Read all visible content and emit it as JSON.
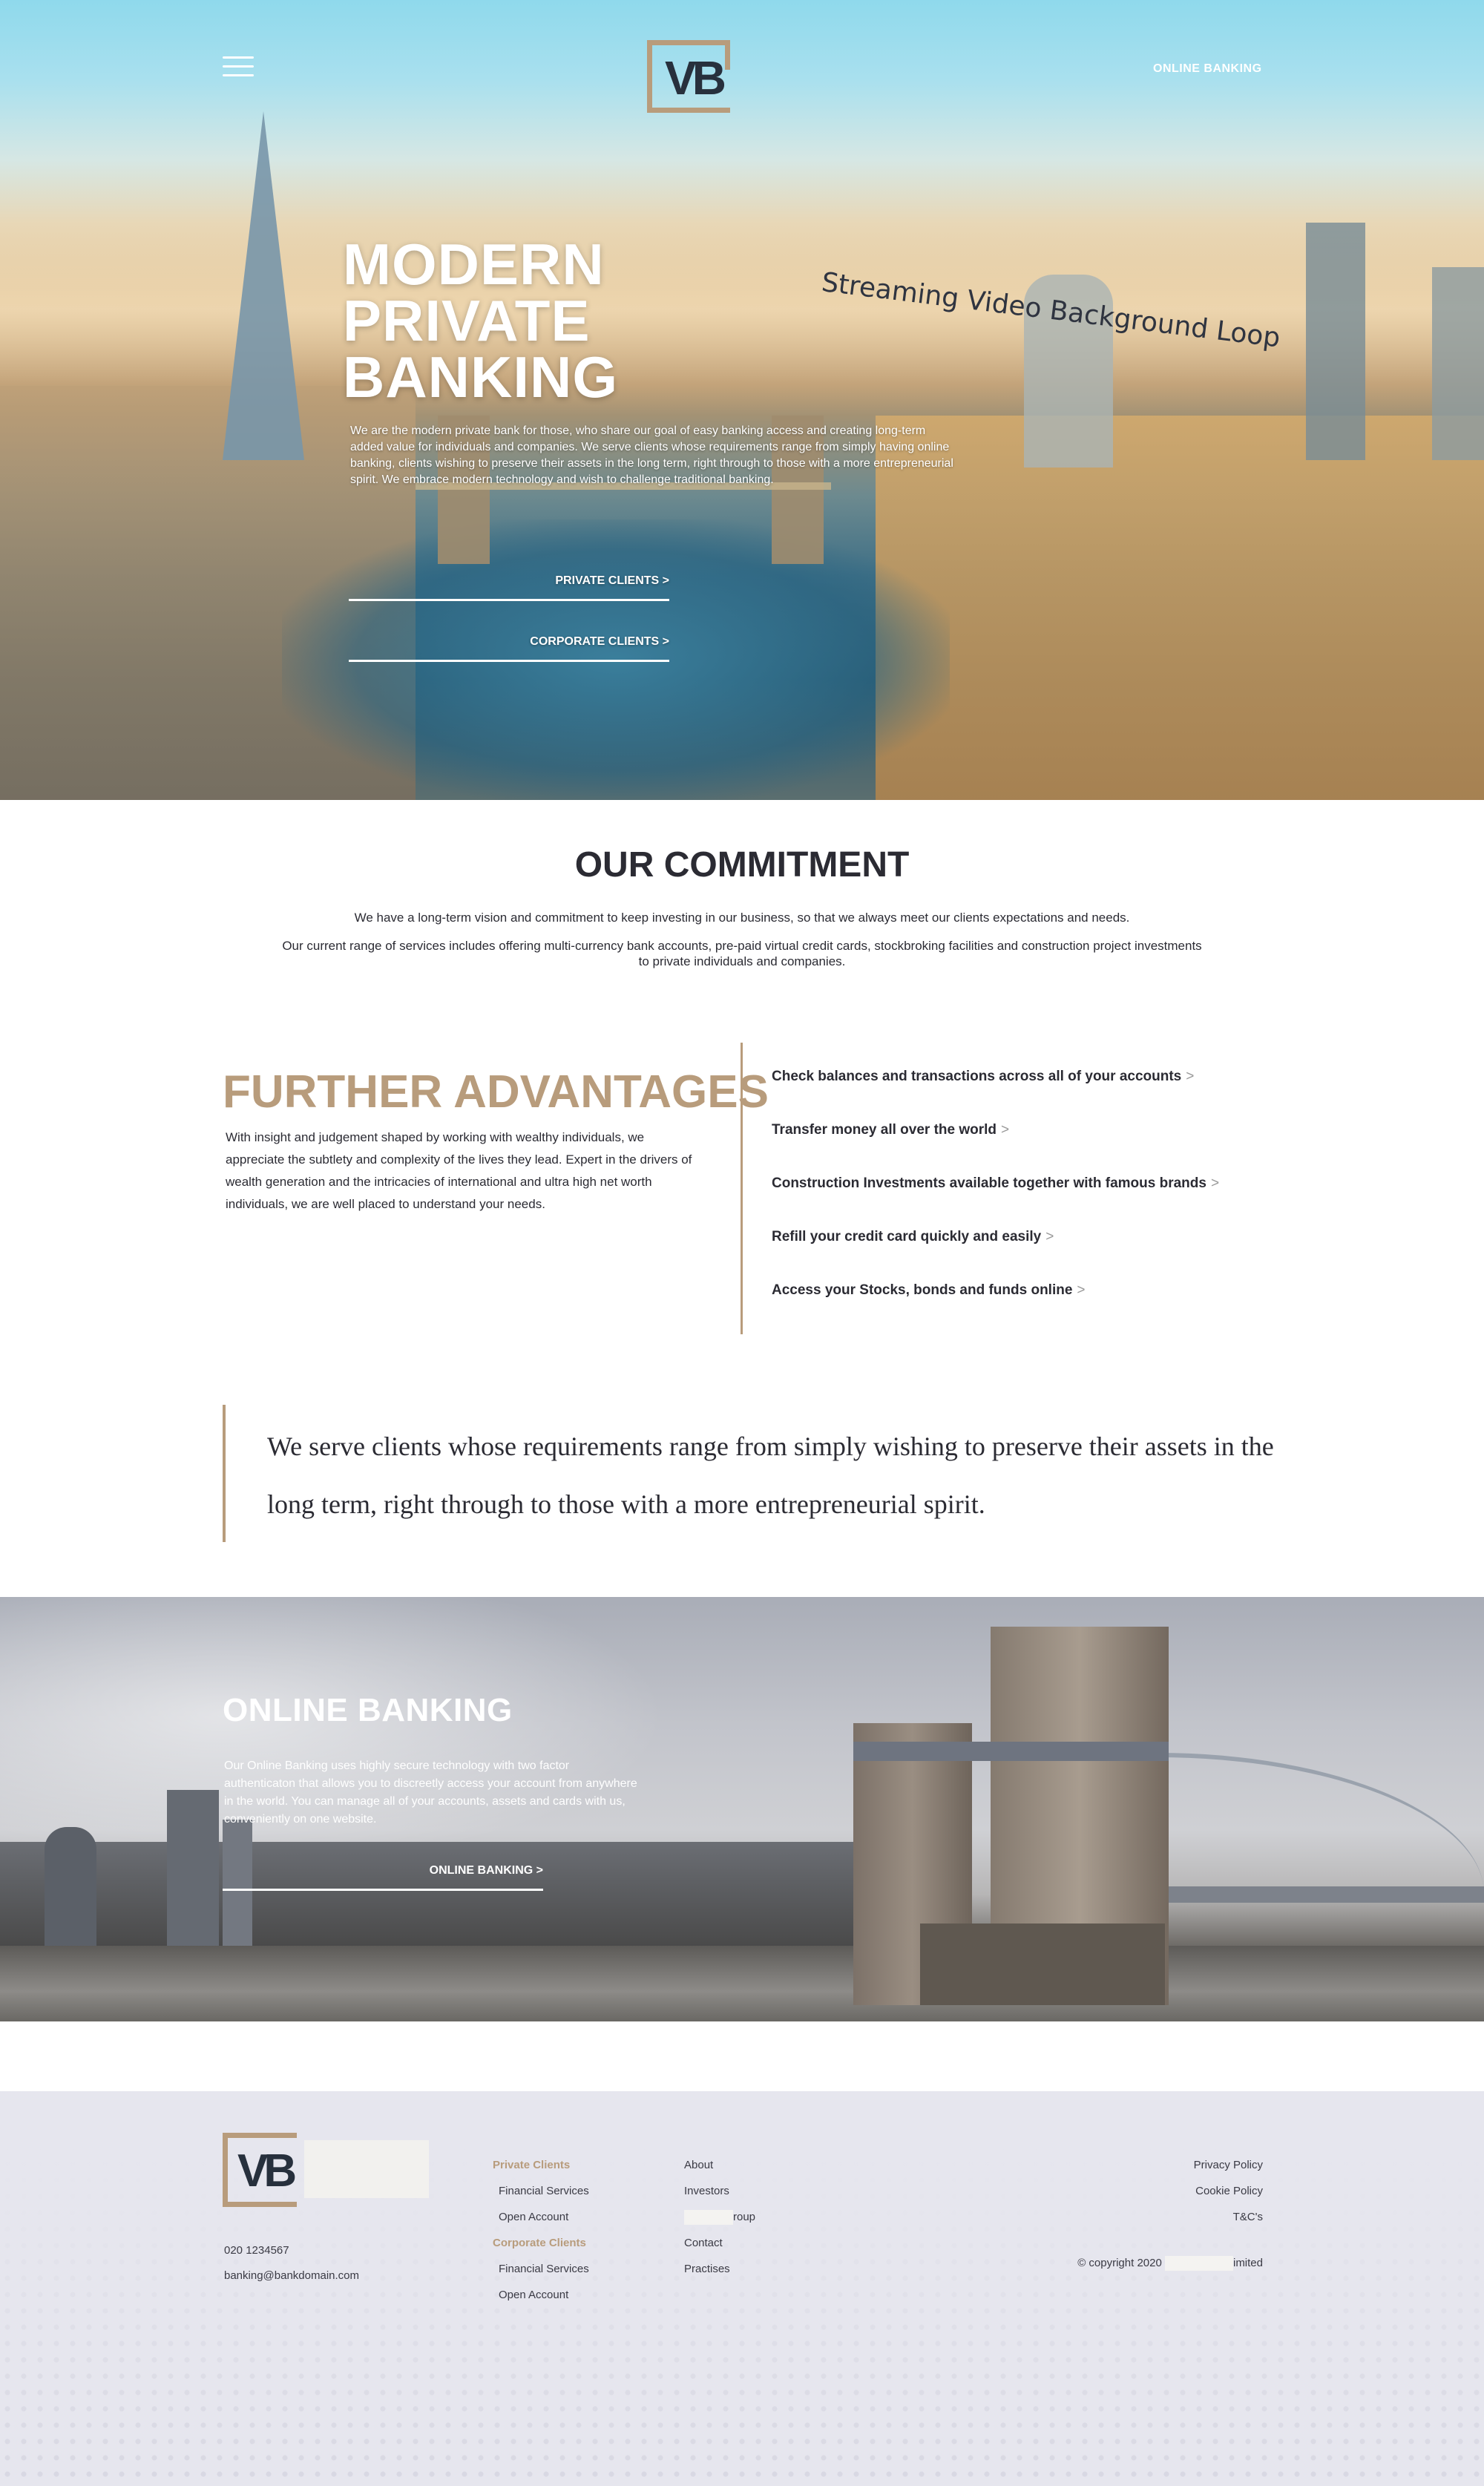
{
  "header": {
    "logo_text": "VB",
    "online_banking_label": "ONLINE BANKING"
  },
  "hero": {
    "title_line1": "MODERN",
    "title_line2": "PRIVATE",
    "title_line3": "BANKING",
    "text": "We are the modern private bank for those, who share our goal of easy banking access and creating long-term added value for individuals and companies. We serve clients whose requirements range from simply having online banking, clients wishing to preserve their assets in the long term, right through to those with a more entrepreneurial spirit. We embrace modern technology and wish to challenge traditional banking.",
    "video_note": "Streaming Video Background Loop",
    "private_clients_label": "PRIVATE CLIENTS >",
    "corporate_clients_label": "CORPORATE CLIENTS >"
  },
  "commitment": {
    "title": "OUR COMMITMENT",
    "p1": "We have a long-term vision and commitment to keep investing in our business, so that we always meet our clients expectations and needs.",
    "p2": "Our current range of services includes offering multi-currency bank accounts, pre-paid virtual credit cards, stockbroking facilities and construction project investments to private individuals and companies."
  },
  "advantages": {
    "title": "FURTHER ADVANTAGES",
    "text": "With insight and judgement shaped by working with wealthy individuals, we appreciate the subtlety and complexity of the lives they lead. Expert in the drivers of wealth generation and the intricacies of international and ultra high net worth individuals, we are well placed to understand your needs.",
    "items": [
      {
        "label": "Check balances and transactions across all of your accounts",
        "arrow": ">"
      },
      {
        "label": "Transfer money all over the world",
        "arrow": ">"
      },
      {
        "label": "Construction Investments available together with famous brands",
        "arrow": ">"
      },
      {
        "label": "Refill your credit card quickly and easily",
        "arrow": ">"
      },
      {
        "label": "Access your Stocks, bonds and funds online",
        "arrow": ">"
      }
    ]
  },
  "quote": {
    "text": "We serve clients whose requirements range from simply wishing to preserve their assets in the long term, right through to those with a more entrepreneurial spirit."
  },
  "online_banking": {
    "title": "ONLINE BANKING",
    "text": "Our Online Banking uses highly secure technology with two factor authenticaton that allows you to discreetly access your account from anywhere in the world. You can manage all of your accounts, assets and cards with us, conveniently on one website.",
    "button_label": "ONLINE BANKING >"
  },
  "footer": {
    "logo_text": "VB",
    "phone": "020 1234567",
    "email": "banking@bankdomain.com",
    "col1": {
      "private_heading": "Private Clients",
      "private_items": [
        "Financial Services",
        "Open Account"
      ],
      "corporate_heading": "Corporate Clients",
      "corporate_items": [
        "Financial Services",
        "Open Account"
      ]
    },
    "col2": {
      "about": "About",
      "investors": "Investors",
      "group_suffix": "roup",
      "contact": "Contact",
      "practises": "Practises"
    },
    "legal": {
      "privacy": "Privacy Policy",
      "cookie": "Cookie Policy",
      "tcs": "T&C's"
    },
    "copyright_prefix": "© copyright 2020",
    "copyright_suffix": "imited"
  },
  "colors": {
    "accent_gold": "#b89c7c",
    "text_dark": "#2b2b33",
    "footer_bg": "#e6e6ee"
  }
}
